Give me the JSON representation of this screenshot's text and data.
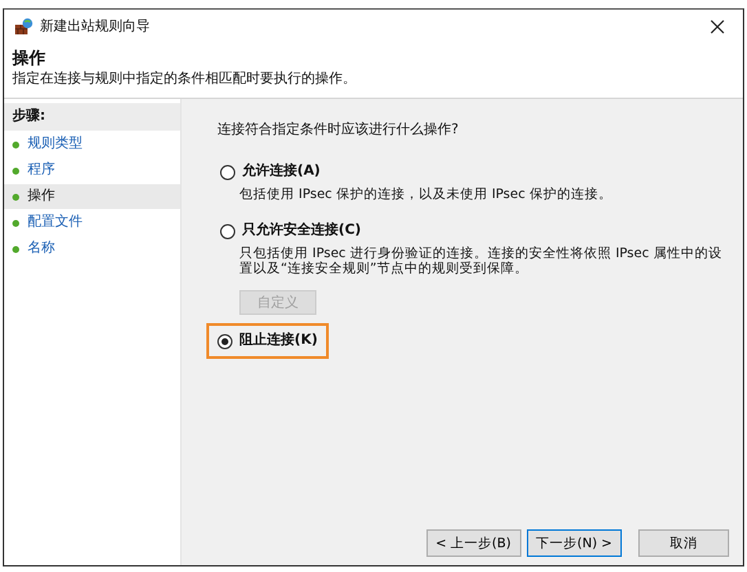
{
  "window": {
    "title": "新建出站规则向导"
  },
  "header": {
    "title": "操作",
    "subtitle": "指定在连接与规则中指定的条件相匹配时要执行的操作。"
  },
  "steps": {
    "label": "步骤:",
    "items": [
      {
        "label": "规则类型",
        "selected": false
      },
      {
        "label": "程序",
        "selected": false
      },
      {
        "label": "操作",
        "selected": true
      },
      {
        "label": "配置文件",
        "selected": false
      },
      {
        "label": "名称",
        "selected": false
      }
    ]
  },
  "question": "连接符合指定条件时应该进行什么操作?",
  "options": [
    {
      "label": "允许连接(A)",
      "description": "包括使用 IPsec 保护的连接，以及未使用 IPsec 保护的连接。",
      "selected": false,
      "highlighted": false
    },
    {
      "label": "只允许安全连接(C)",
      "description": "只包括使用 IPsec 进行身份验证的连接。连接的安全性将依照 IPsec 属性中的设置以及“连接安全规则”节点中的规则受到保障。",
      "selected": false,
      "highlighted": false,
      "button": {
        "label": "自定义",
        "disabled": true
      }
    },
    {
      "label": "阻止连接(K)",
      "selected": true,
      "highlighted": true
    }
  ],
  "buttons": [
    {
      "label": "< 上一步(B)",
      "default": false
    },
    {
      "label": "下一步(N) >",
      "default": true
    },
    {
      "label": "取消",
      "default": false
    }
  ]
}
